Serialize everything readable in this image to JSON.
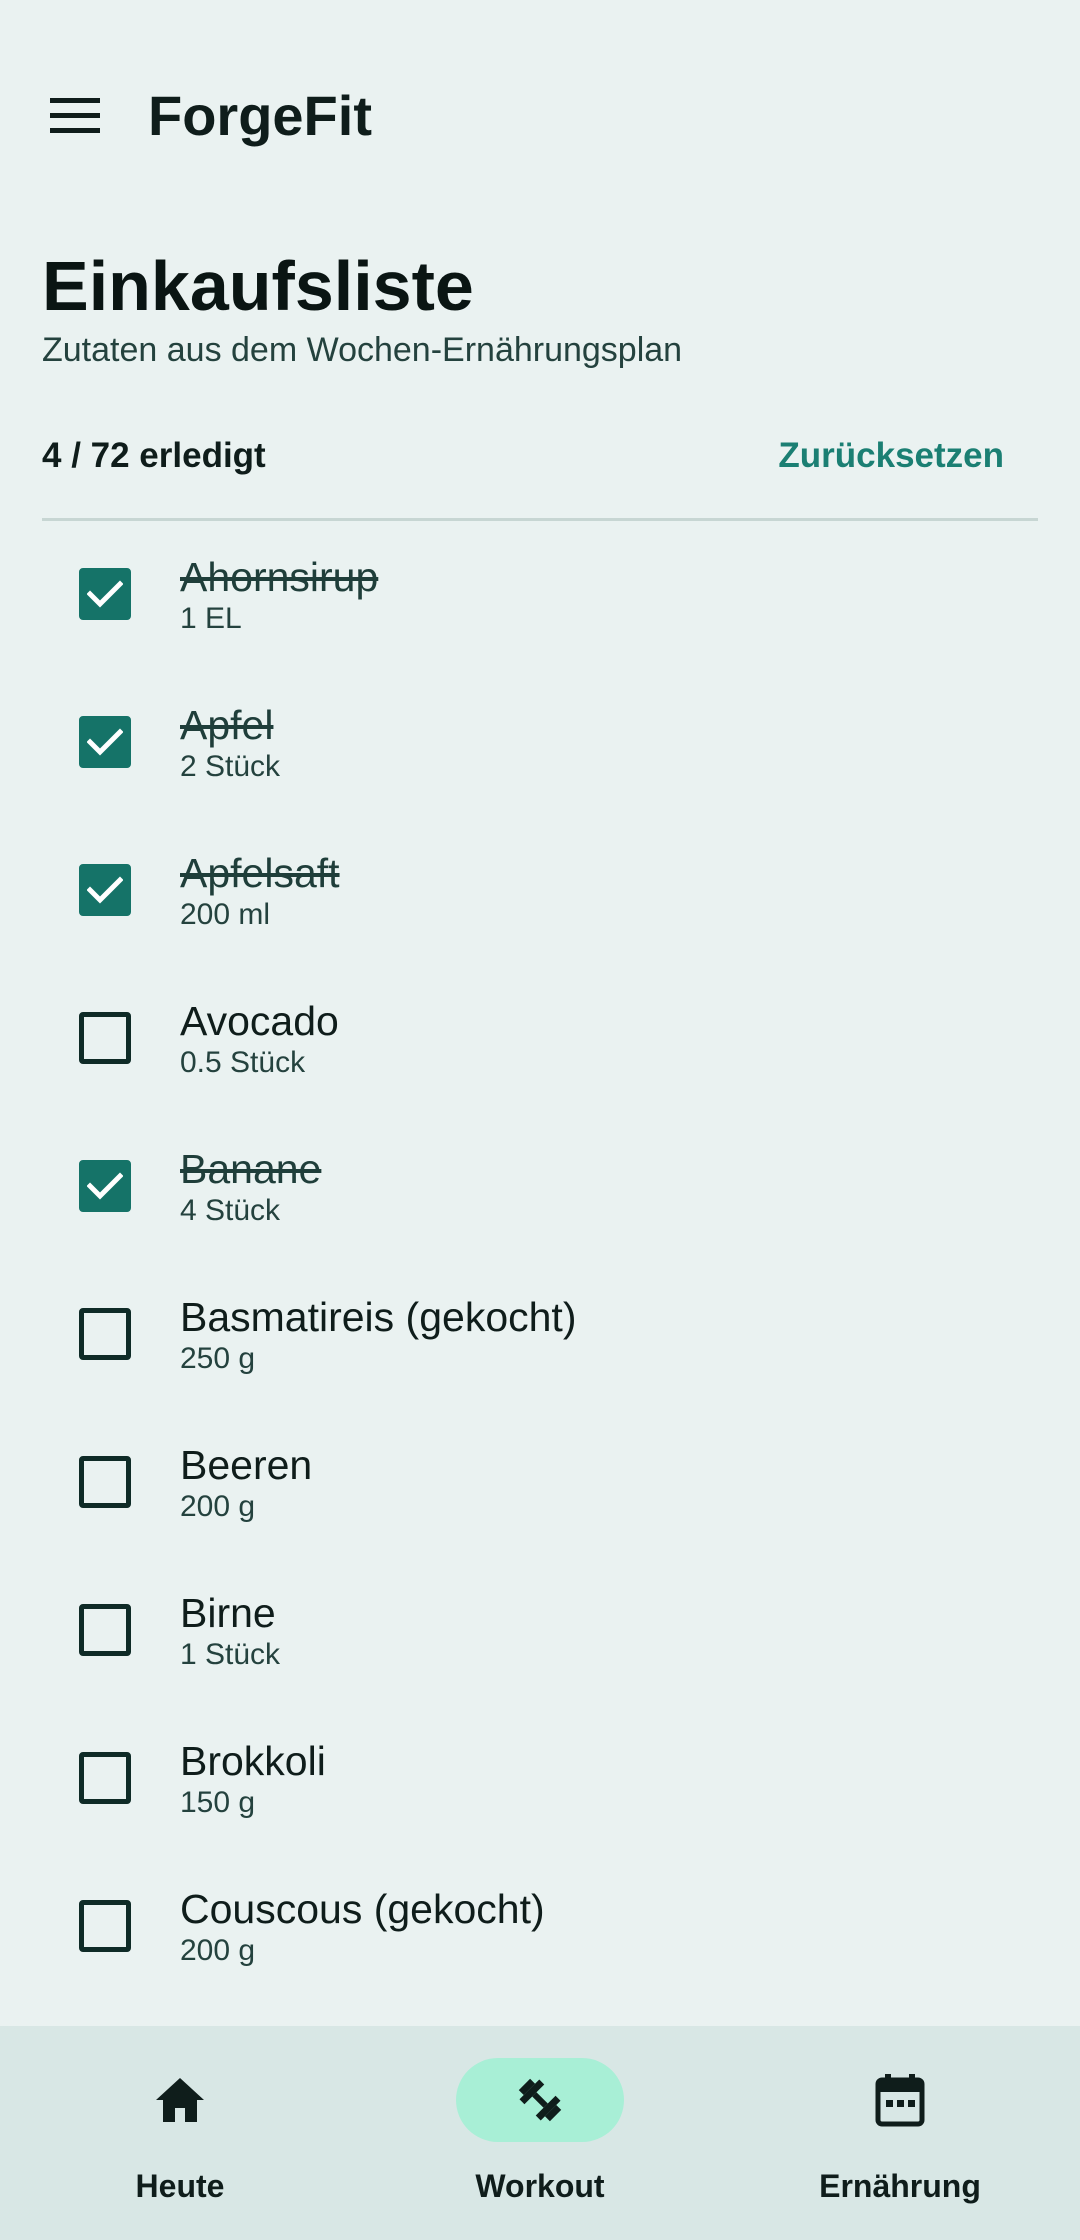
{
  "app": {
    "title": "ForgeFit"
  },
  "page": {
    "heading": "Einkaufsliste",
    "subheading": "Zutaten aus dem Wochen-Ernährungsplan",
    "progress": "4 / 72 erledigt",
    "reset_label": "Zurücksetzen"
  },
  "items": [
    {
      "name": "Ahornsirup",
      "qty": "1 EL",
      "checked": true
    },
    {
      "name": "Apfel",
      "qty": "2 Stück",
      "checked": true
    },
    {
      "name": "Apfelsaft",
      "qty": "200 ml",
      "checked": true
    },
    {
      "name": "Avocado",
      "qty": "0.5 Stück",
      "checked": false
    },
    {
      "name": "Banane",
      "qty": "4 Stück",
      "checked": true
    },
    {
      "name": "Basmatireis (gekocht)",
      "qty": "250 g",
      "checked": false
    },
    {
      "name": "Beeren",
      "qty": "200 g",
      "checked": false
    },
    {
      "name": "Birne",
      "qty": "1 Stück",
      "checked": false
    },
    {
      "name": "Brokkoli",
      "qty": "150 g",
      "checked": false
    },
    {
      "name": "Couscous (gekocht)",
      "qty": "200 g",
      "checked": false
    }
  ],
  "nav": [
    {
      "label": "Heute",
      "icon": "home-icon",
      "active": false
    },
    {
      "label": "Workout",
      "icon": "dumbbell-icon",
      "active": true
    },
    {
      "label": "Ernährung",
      "icon": "calendar-icon",
      "active": false
    }
  ],
  "colors": {
    "background": "#eaf2f1",
    "accent": "#157368",
    "link": "#1b7f73",
    "nav_background": "#d8e7e5",
    "nav_active_pill": "#a8efd6"
  }
}
